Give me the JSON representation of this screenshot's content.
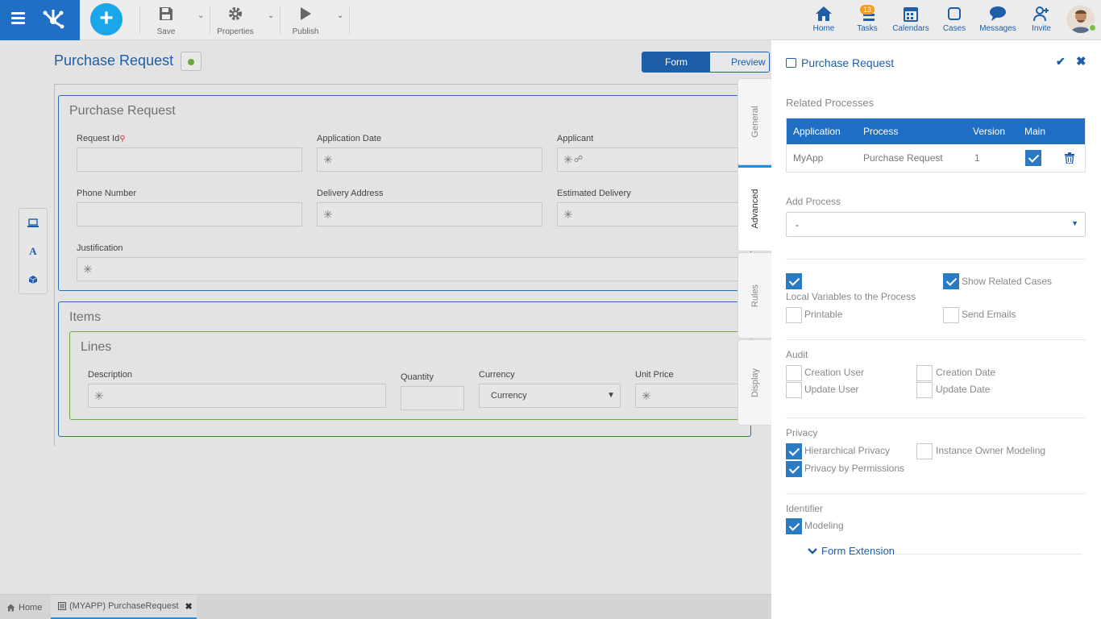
{
  "topbar": {
    "save_label": "Save",
    "properties_label": "Properties",
    "publish_label": "Publish",
    "nav": [
      {
        "label": "Home",
        "icon": "home-icon"
      },
      {
        "label": "Tasks",
        "icon": "tasks-icon",
        "badge": "13"
      },
      {
        "label": "Calendars",
        "icon": "calendar-icon"
      },
      {
        "label": "Cases",
        "icon": "cases-icon"
      },
      {
        "label": "Messages",
        "icon": "messages-icon"
      },
      {
        "label": "Invite",
        "icon": "invite-icon"
      }
    ]
  },
  "canvas": {
    "title": "Purchase Request",
    "form_tab": "Form",
    "preview_tab": "Preview",
    "section1": {
      "title": "Purchase Request",
      "fields": {
        "request_id": "Request Id",
        "application_date": "Application Date",
        "applicant": "Applicant",
        "phone_number": "Phone Number",
        "delivery_address": "Delivery Address",
        "estimated_delivery": "Estimated Delivery",
        "justification": "Justification"
      }
    },
    "section2": {
      "title": "Items",
      "lines_title": "Lines",
      "fields": {
        "description": "Description",
        "quantity": "Quantity",
        "currency": "Currency",
        "currency_value": "Currency",
        "unit_price": "Unit Price"
      }
    }
  },
  "vtabs": {
    "general": "General",
    "advanced": "Advanced",
    "rules": "Rules",
    "display": "Display"
  },
  "panel": {
    "title": "Purchase Request",
    "related_processes_heading": "Related Processes",
    "table": {
      "headers": [
        "Application",
        "Process",
        "Version",
        "Main"
      ],
      "row": {
        "application": "MyApp",
        "process": "Purchase Request",
        "version": "1",
        "main": true
      }
    },
    "add_process_label": "Add Process",
    "add_process_value": "-",
    "options": {
      "local_variables": {
        "label": "Local Variables to the Process",
        "checked": true
      },
      "show_related_cases": {
        "label": "Show Related Cases",
        "checked": true
      },
      "printable": {
        "label": "Printable",
        "checked": false
      },
      "send_emails": {
        "label": "Send Emails",
        "checked": false
      }
    },
    "audit": {
      "heading": "Audit",
      "creation_user": {
        "label": "Creation User",
        "checked": false
      },
      "creation_date": {
        "label": "Creation Date",
        "checked": false
      },
      "update_user": {
        "label": "Update User",
        "checked": false
      },
      "update_date": {
        "label": "Update Date",
        "checked": false
      }
    },
    "privacy": {
      "heading": "Privacy",
      "hierarchical": {
        "label": "Hierarchical Privacy",
        "checked": true
      },
      "instance_owner": {
        "label": "Instance Owner Modeling",
        "checked": false
      },
      "by_permissions": {
        "label": "Privacy by Permissions",
        "checked": true
      }
    },
    "identifier": {
      "heading": "Identifier",
      "modeling": {
        "label": "Modeling",
        "checked": true
      }
    },
    "form_extension": "Form Extension"
  },
  "bottom_tabs": {
    "home": "Home",
    "active": "(MYAPP) PurchaseRequest"
  },
  "colors": {
    "brand": "#1f6fc4",
    "accent": "#1aa7ea",
    "badge": "#f29d1b",
    "status_online": "#7cc142"
  }
}
